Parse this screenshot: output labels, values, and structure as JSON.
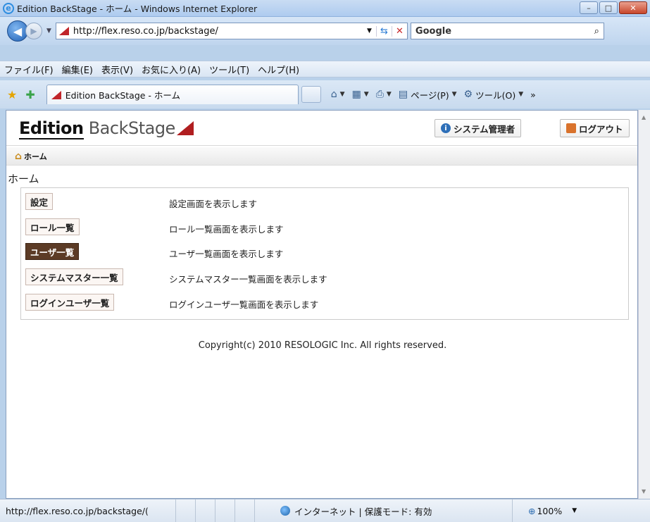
{
  "window": {
    "title": "Edition BackStage - ホーム - Windows Internet Explorer",
    "logo_letter": "e",
    "buttons": {
      "minimize": "–",
      "maximize": "□",
      "close": "✕"
    }
  },
  "address_bar": {
    "back": "◀",
    "forward": "▶",
    "url": "http://flex.reso.co.jp/backstage/",
    "dropdown": "▼",
    "refresh": "⇆",
    "stop": "✕",
    "search_value": "Google",
    "search_icon": "⌕"
  },
  "menu": {
    "items": [
      "ファイル(F)",
      "編集(E)",
      "表示(V)",
      "お気に入り(A)",
      "ツール(T)",
      "ヘルプ(H)"
    ]
  },
  "tabs": {
    "star1": "★",
    "star2": "✚",
    "active_tab": "Edition BackStage - ホーム",
    "commands": {
      "home": "⌂",
      "feeds": "▦",
      "print": "⎙",
      "page": "ページ(P)",
      "tools": "ツール(O)",
      "more": "»"
    }
  },
  "app": {
    "logo_edition": "Edition",
    "logo_backstage": " BackStage",
    "header_buttons": {
      "admin": "システム管理者",
      "logout": "ログアウト"
    },
    "breadcrumb": "ホーム",
    "page_title": "ホーム",
    "menu_items": [
      {
        "label": "設定",
        "description": "設定画面を表示します"
      },
      {
        "label": "ロール一覧",
        "description": "ロール一覧画面を表示します"
      },
      {
        "label": "ユーザ一覧",
        "description": "ユーザ一覧画面を表示します"
      },
      {
        "label": "システムマスター一覧",
        "description": "システムマスター一覧画面を表示します"
      },
      {
        "label": "ログインユーザ一覧",
        "description": "ログインユーザ一覧画面を表示します"
      }
    ],
    "copyright": "Copyright(c) 2010 RESOLOGIC Inc. All rights reserved."
  },
  "status_bar": {
    "url": "http://flex.reso.co.jp/backstage/(",
    "zone": "インターネット | 保護モード: 有効",
    "zoom": "100%"
  },
  "colors": {
    "brand_red": "#b01e20",
    "active_menu_bg": "#5c3b26"
  }
}
